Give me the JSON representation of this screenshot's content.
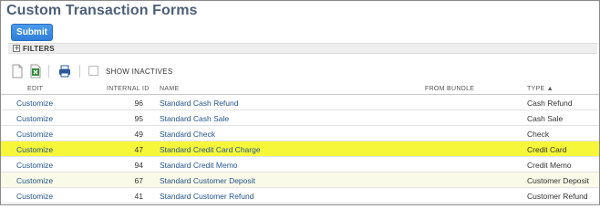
{
  "page": {
    "title": "Custom Transaction Forms"
  },
  "actions": {
    "submit_label": "Submit"
  },
  "filters": {
    "label": "FILTERS",
    "toggle": "+"
  },
  "toolbar": {
    "show_inactives_label": "SHOW INACTIVES",
    "show_inactives_checked": false
  },
  "table": {
    "columns": [
      "EDIT",
      "INTERNAL ID",
      "NAME",
      "FROM BUNDLE",
      "TYPE ▲"
    ],
    "rows": [
      {
        "edit": "Customize",
        "id": "96",
        "name": "Standard Cash Refund",
        "bundle": "",
        "type": "Cash Refund"
      },
      {
        "edit": "Customize",
        "id": "95",
        "name": "Standard Cash Sale",
        "bundle": "",
        "type": "Cash Sale"
      },
      {
        "edit": "Customize",
        "id": "49",
        "name": "Standard Check",
        "bundle": "",
        "type": "Check"
      },
      {
        "edit": "Customize",
        "id": "47",
        "name": "Standard Credit Card Charge",
        "bundle": "",
        "type": "Credit Card"
      },
      {
        "edit": "Customize",
        "id": "94",
        "name": "Standard Credit Memo",
        "bundle": "",
        "type": "Credit Memo"
      },
      {
        "edit": "Customize",
        "id": "67",
        "name": "Standard Customer Deposit",
        "bundle": "",
        "type": "Customer Deposit"
      },
      {
        "edit": "Customize",
        "id": "41",
        "name": "Standard Customer Refund",
        "bundle": "",
        "type": "Customer Refund"
      }
    ]
  },
  "colors": {
    "title": "#4d5f79",
    "link": "#23558f",
    "button": "#2f7fd9",
    "highlight": "#f7f73a"
  },
  "icons": [
    "new-document-icon",
    "export-excel-icon",
    "print-icon"
  ]
}
